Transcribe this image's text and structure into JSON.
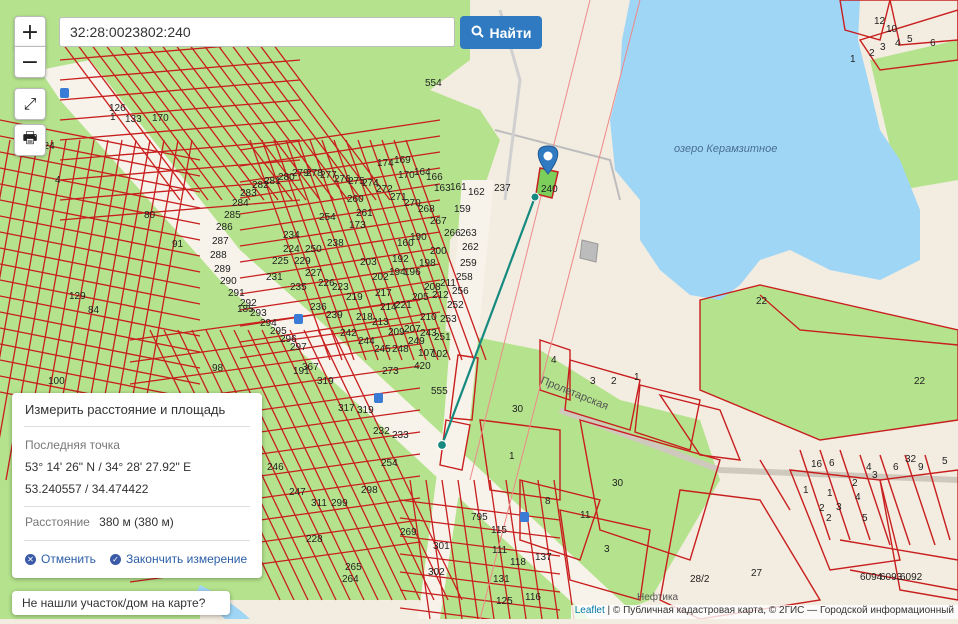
{
  "search": {
    "value": "32:28:0023802:240",
    "find_label": "Найти"
  },
  "controls": {
    "zoom_in": "+",
    "zoom_out": "−"
  },
  "colors": {
    "water": "#9fd6f6",
    "parcel_green": "#b5e38d",
    "land": "#f3ece0",
    "boundary": "#c81e1e",
    "route": "#168a80",
    "marker": "#2f7ac1"
  },
  "map_labels": {
    "lake": "озеро Керамзитное",
    "street": "Пролетарская",
    "poi": "Нефтика"
  },
  "parcel_numbers": [
    "554",
    "237",
    "240",
    "22",
    "22",
    "4",
    "3",
    "2",
    "1",
    "30",
    "30",
    "1",
    "8",
    "11",
    "3",
    "27",
    "28/2",
    "6",
    "5",
    "4",
    "3",
    "2",
    "1",
    "10",
    "12",
    "16",
    "6",
    "6",
    "9",
    "5",
    "4",
    "3",
    "2",
    "32",
    "6094",
    "6093",
    "6092",
    "1",
    "1",
    "2",
    "3",
    "4",
    "5",
    "2",
    "1",
    "170",
    "133",
    "126",
    "124",
    "4",
    "80",
    "91",
    "129",
    "84",
    "100",
    "98",
    "185",
    "191",
    "367",
    "319",
    "317",
    "319",
    "232",
    "233",
    "246",
    "247",
    "311",
    "299",
    "298",
    "254",
    "269",
    "264",
    "265",
    "228",
    "301",
    "302",
    "795",
    "115",
    "111",
    "118",
    "116",
    "137",
    "131",
    "125",
    "273",
    "420",
    "107",
    "102",
    "555",
    "234",
    "250",
    "254",
    "238",
    "260",
    "261",
    "173",
    "174",
    "169",
    "170",
    "164",
    "166",
    "163",
    "161",
    "162",
    "159",
    "160",
    "190",
    "192",
    "194",
    "196",
    "198",
    "200",
    "203",
    "202",
    "217",
    "214",
    "221",
    "205",
    "208",
    "212",
    "211",
    "210",
    "207",
    "209",
    "213",
    "218",
    "219",
    "223",
    "226",
    "227",
    "229",
    "224",
    "225",
    "231",
    "235",
    "236",
    "239",
    "242",
    "244",
    "245",
    "248",
    "249",
    "243",
    "251",
    "253",
    "252",
    "256",
    "258",
    "259",
    "262",
    "263",
    "266",
    "267",
    "268",
    "270",
    "271",
    "272",
    "274",
    "275",
    "276",
    "277",
    "278",
    "279",
    "280",
    "281",
    "282",
    "283",
    "284",
    "285",
    "286",
    "287",
    "288",
    "289",
    "290",
    "291",
    "292",
    "293",
    "294",
    "295",
    "296",
    "297"
  ],
  "measure": {
    "title": "Измерить расстояние и площадь",
    "last_point_label": "Последняя точка",
    "coords_dms": "53° 14' 26\" N / 34° 28' 27.92\" E",
    "coords_dec": "53.240557 / 34.474422",
    "distance_label": "Расстояние",
    "distance_value": "380 м (380 м)",
    "cancel_label": "Отменить",
    "finish_label": "Закончить измерение"
  },
  "not_found_label": "Не нашли участок/дом на карте?",
  "attribution": {
    "leaflet": "Leaflet",
    "rest": " | © Публичная кадастровая карта, © 2ГИС — Городской информационный"
  },
  "icons": [
    "search-icon",
    "fullscreen-icon",
    "print-icon",
    "map-marker-icon",
    "close-circle-icon",
    "check-circle-icon",
    "bus-stop-icon"
  ]
}
